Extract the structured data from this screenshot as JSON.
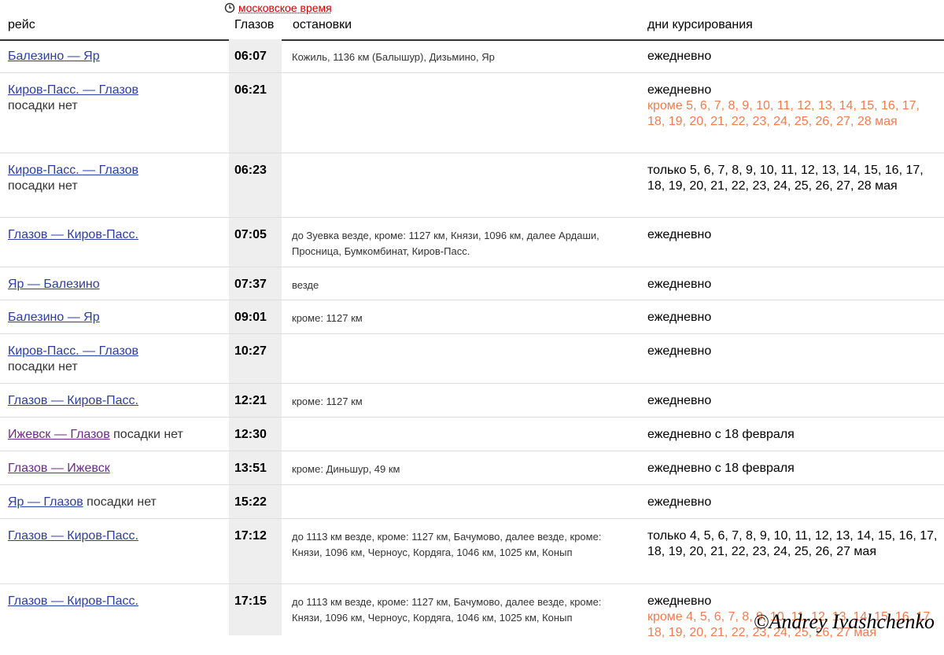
{
  "header": {
    "timezone_label": "московское время",
    "timezone_icon": "clock-icon",
    "col_route": "рейс",
    "col_time": "Глазов",
    "col_stops": "остановки",
    "col_days": "дни курсирования"
  },
  "rows": [
    {
      "route": "Балезино — Яр",
      "note": "",
      "time": "06:07",
      "stops": "Кожиль, 1136 км (Балышур), Дизьмино, Яр",
      "days": "ежедневно",
      "except": ""
    },
    {
      "route": "Киров-Пасс. — Глазов",
      "note": "посадки нет",
      "time": "06:21",
      "stops": "",
      "days": "ежедневно",
      "except": "кроме 5, 6, 7, 8, 9, 10, 11, 12, 13, 14, 15, 16, 17, 18, 19, 20, 21, 22, 23, 24, 25, 26, 27, 28 мая"
    },
    {
      "route": "Киров-Пасс. — Глазов",
      "note": "посадки нет",
      "time": "06:23",
      "stops": "",
      "days": "только 5, 6, 7, 8, 9, 10, 11, 12, 13, 14, 15, 16, 17, 18, 19, 20, 21, 22, 23, 24, 25, 26, 27, 28 мая",
      "except": ""
    },
    {
      "route": "Глазов — Киров-Пасс.",
      "note": "",
      "time": "07:05",
      "stops": "до Зуевка везде, кроме: 1127 км, Князи, 1096 км, далее Ардаши, Просница, Бумкомбинат, Киров-Пасс.",
      "days": "ежедневно",
      "except": ""
    },
    {
      "route": "Яр — Балезино",
      "note": "",
      "time": "07:37",
      "stops": "везде",
      "days": "ежедневно",
      "except": ""
    },
    {
      "route": "Балезино — Яр",
      "note": "",
      "time": "09:01",
      "stops": "кроме: 1127 км",
      "days": "ежедневно",
      "except": ""
    },
    {
      "route": "Киров-Пасс. — Глазов",
      "note": "посадки нет",
      "time": "10:27",
      "stops": "",
      "days": "ежедневно",
      "except": ""
    },
    {
      "route": "Глазов — Киров-Пасс.",
      "note": "",
      "time": "12:21",
      "stops": "кроме: 1127 км",
      "days": "ежедневно",
      "except": ""
    },
    {
      "route": "Ижевск — Глазов",
      "note": "посадки нет",
      "time": "12:30",
      "stops": "",
      "days": "ежедневно с 18 февраля",
      "except": ""
    },
    {
      "route": "Глазов — Ижевск",
      "note": "",
      "time": "13:51",
      "stops": "кроме: Диньшур, 49 км",
      "days": "ежедневно с 18 февраля",
      "except": ""
    },
    {
      "route": "Яр — Глазов",
      "note": "посадки нет",
      "time": "15:22",
      "stops": "",
      "days": "ежедневно",
      "except": ""
    },
    {
      "route": "Глазов — Киров-Пасс.",
      "note": "",
      "time": "17:12",
      "stops": "до 1113 км везде, кроме: 1127 км, Бачумово, далее везде, кроме: Князи, 1096 км, Черноус, Кордяга, 1046 км, 1025 км, Конып",
      "days": "только 4, 5, 6, 7, 8, 9, 10, 11, 12, 13, 14, 15, 16, 17, 18, 19, 20, 21, 22, 23, 24, 25, 26, 27 мая",
      "except": ""
    },
    {
      "route": "Глазов — Киров-Пасс.",
      "note": "",
      "time": "17:15",
      "stops": "до 1113 км везде, кроме: 1127 км, Бачумово, далее везде, кроме: Князи, 1096 км, Черноус, Кордяга, 1046 км, 1025 км, Конып",
      "days": "ежедневно",
      "except": "кроме 4, 5, 6, 7, 8, 9, 10, 11, 12, 13, 14, 15, 16, 17, 18, 19, 20, 21, 22, 23, 24, 25, 26, 27 мая"
    }
  ],
  "watermark": "©Andrey Ivashchenko",
  "colors": {
    "link": "#2a3da8",
    "visited": "#6b2a8a",
    "exception": "#f47b4b",
    "timezone": "#cc0000"
  }
}
